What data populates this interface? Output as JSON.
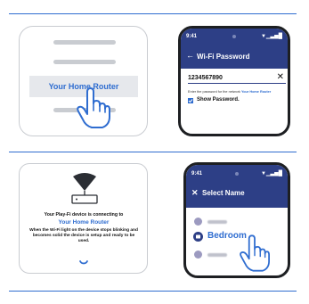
{
  "dividers": [
    "top",
    "middle",
    "bottom"
  ],
  "step1": {
    "router_label": "Your Home Router"
  },
  "step2": {
    "status_time": "9:41",
    "status_icons": "▼▁▃▅█",
    "header_title": "Wi-Fi Password",
    "password_value": "1234567890",
    "clear_glyph": "✕",
    "hint_prefix": "Enter the password for the network",
    "hint_network": "Your Home Router",
    "show_password_label": "Show Password."
  },
  "step3": {
    "line1": "Your Play-Fi device is connecting to",
    "network": "Your Home Router",
    "line3": "When the Wi-Fi light on the device stops blinking and becomes solid the device is setup and ready to be used."
  },
  "step4": {
    "status_time": "9:41",
    "status_icons": "▼▁▃▅█",
    "header_title": "Select Name",
    "selected_name": "Bedroom"
  },
  "colors": {
    "accent": "#2f6dd0",
    "header": "#2d3f86",
    "bar": "#c9ccd1"
  }
}
